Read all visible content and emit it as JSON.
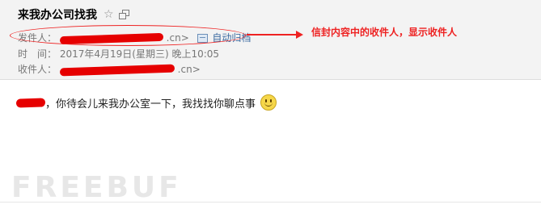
{
  "email": {
    "subject": "来我办公司找我",
    "sender_label": "发件人：",
    "sender_suffix": ".cn>",
    "archive_label": "自动归档",
    "time_label": "时　间：",
    "time_value": "2017年4月19日(星期三) 晚上10:05",
    "recipient_label": "收件人：",
    "recipient_suffix": ".cn>",
    "body_text": "，你待会儿来我办公室一下，我找找你聊点事"
  },
  "annotation": {
    "text": "信封内容中的收件人，显示收件人"
  },
  "watermark": {
    "text": "FREEBUF"
  },
  "colors": {
    "annotation_red": "#ee2222",
    "header_bg": "#f3f3f3",
    "redaction": "#e60000"
  },
  "icons": [
    "star-icon",
    "popout-icon",
    "archive-icon",
    "smiley-icon"
  ]
}
